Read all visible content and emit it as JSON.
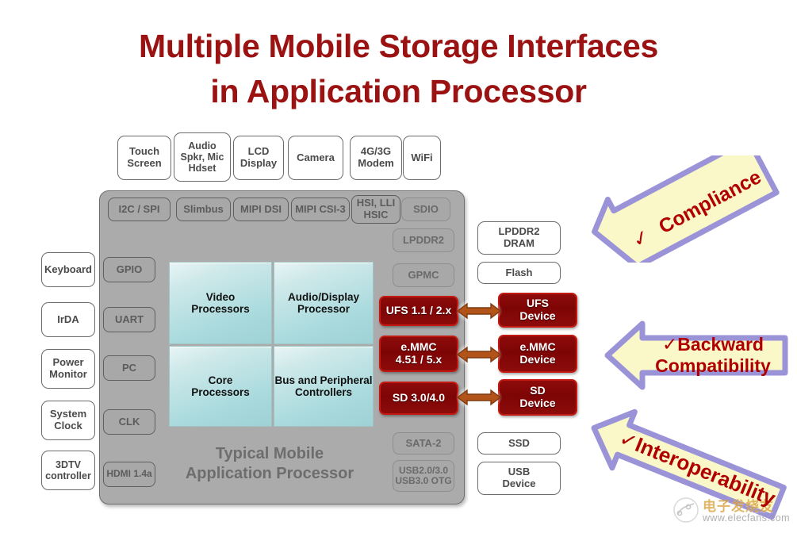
{
  "title": {
    "line1": "Multiple Mobile Storage Interfaces",
    "line2": "in Application Processor",
    "color": "#9B1212"
  },
  "chip": {
    "caption_line1": "Typical Mobile",
    "caption_line2": "Application Processor",
    "body_color": "#ababab"
  },
  "top_peripherals": [
    {
      "label": "Touch\nScreen"
    },
    {
      "label": "Audio\nSpkr, Mic\nHdset"
    },
    {
      "label": "LCD\nDisplay"
    },
    {
      "label": "Camera"
    },
    {
      "label": "4G/3G\nModem"
    },
    {
      "label": "WiFi"
    }
  ],
  "top_interfaces": [
    {
      "label": "I2C / SPI"
    },
    {
      "label": "Slimbus"
    },
    {
      "label": "MIPI DSI"
    },
    {
      "label": "MIPI CSI-3"
    },
    {
      "label": "HSI, LLI\nHSIC"
    },
    {
      "label": "SDIO"
    }
  ],
  "left_peripherals": [
    {
      "label": "Keyboard"
    },
    {
      "label": "IrDA"
    },
    {
      "label": "Power\nMonitor"
    },
    {
      "label": "System\nClock"
    },
    {
      "label": "3DTV\ncontroller"
    }
  ],
  "left_interfaces": [
    {
      "label": "GPIO"
    },
    {
      "label": "UART"
    },
    {
      "label": "PC"
    },
    {
      "label": "CLK"
    },
    {
      "label": "HDMI 1.4a"
    }
  ],
  "right_interfaces": [
    {
      "label": "LPDDR2"
    },
    {
      "label": "GPMC"
    },
    {
      "label": "SATA-2"
    },
    {
      "label": "USB2.0/3.0\nUSB3.0 OTG"
    }
  ],
  "right_devices": [
    {
      "label": "LPDDR2\nDRAM"
    },
    {
      "label": "Flash"
    },
    {
      "label": "SSD"
    },
    {
      "label": "USB\nDevice"
    }
  ],
  "storage": {
    "accent_color": "#8d0b0b",
    "border_color": "#c21a12",
    "interfaces": [
      {
        "label": "UFS 1.1 / 2.x"
      },
      {
        "label": "e.MMC\n4.51 / 5.x"
      },
      {
        "label": "SD 3.0/4.0"
      }
    ],
    "devices": [
      {
        "label": "UFS\nDevice"
      },
      {
        "label": "e.MMC\nDevice"
      },
      {
        "label": "SD\nDevice"
      }
    ],
    "connector_icon": "double-arrow-icon"
  },
  "callouts": [
    {
      "check": "✓",
      "label": "Compliance"
    },
    {
      "check": "✓",
      "label": "Backward\nCompatibility"
    },
    {
      "check": "✓",
      "label": "Interoperability"
    }
  ],
  "watermark": {
    "cn": "电子发烧友",
    "url": "www.elecfans.com",
    "icon": "elecfans-logo-icon"
  }
}
